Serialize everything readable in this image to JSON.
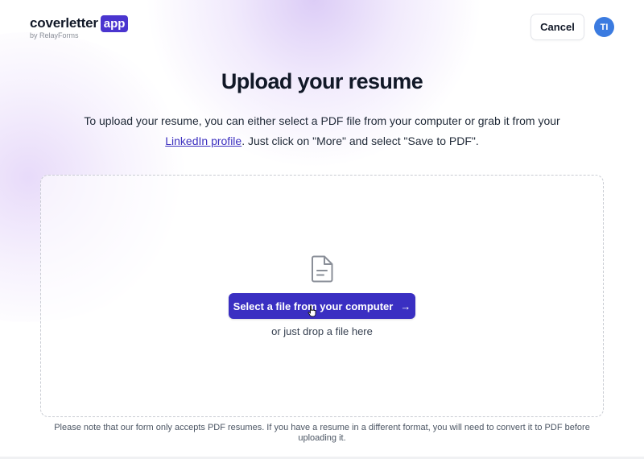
{
  "header": {
    "logo_word": "coverletter",
    "logo_badge": "app",
    "logo_sub": "by RelayForms",
    "cancel_label": "Cancel",
    "avatar_initials": "TI"
  },
  "main": {
    "title": "Upload your resume",
    "intro_before": "To upload your resume, you can either select a PDF file from your computer or grab it from your",
    "intro_link": "LinkedIn profile",
    "intro_after": ". Just click on \"More\" and select \"Save to PDF\"."
  },
  "dropzone": {
    "file_icon": "document-icon",
    "select_label": "Select a file from your computer",
    "arrow_icon": "arrow-right-icon",
    "drop_hint": "or just drop a file here"
  },
  "footer_note": "Please note that our form only accepts PDF resumes. If you have a resume in a different format, you will need to convert it to PDF before uploading it.",
  "colors": {
    "brand": "#4a35cf",
    "primary_button": "#3a2fc2",
    "avatar": "#3b7be0"
  }
}
